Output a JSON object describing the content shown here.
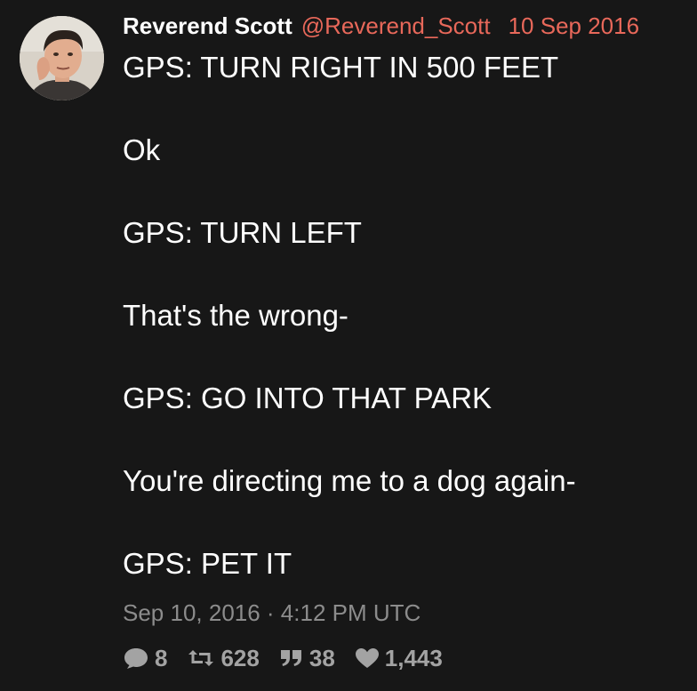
{
  "tweet": {
    "display_name": "Reverend Scott",
    "handle": "@Reverend_Scott",
    "date": "10 Sep 2016",
    "lines": [
      "GPS: TURN RIGHT IN 500 FEET",
      "Ok",
      "GPS: TURN LEFT",
      "That's the wrong-",
      "GPS: GO INTO THAT PARK",
      "You're directing me to a dog again-",
      "GPS: PET IT"
    ],
    "timestamp": "Sep 10, 2016 · 4:12 PM UTC",
    "stats": {
      "replies": "8",
      "retweets": "628",
      "quotes": "38",
      "likes": "1,443"
    }
  },
  "icons": {
    "avatar": "avatar-photo",
    "replies": "comment-icon",
    "retweets": "retweet-icon",
    "quotes": "quote-icon",
    "likes": "heart-icon"
  },
  "colors": {
    "background": "#171717",
    "accent": "#e8685a",
    "text": "#ffffff",
    "muted": "#8c8c8c",
    "stat": "#a3a3a3"
  }
}
